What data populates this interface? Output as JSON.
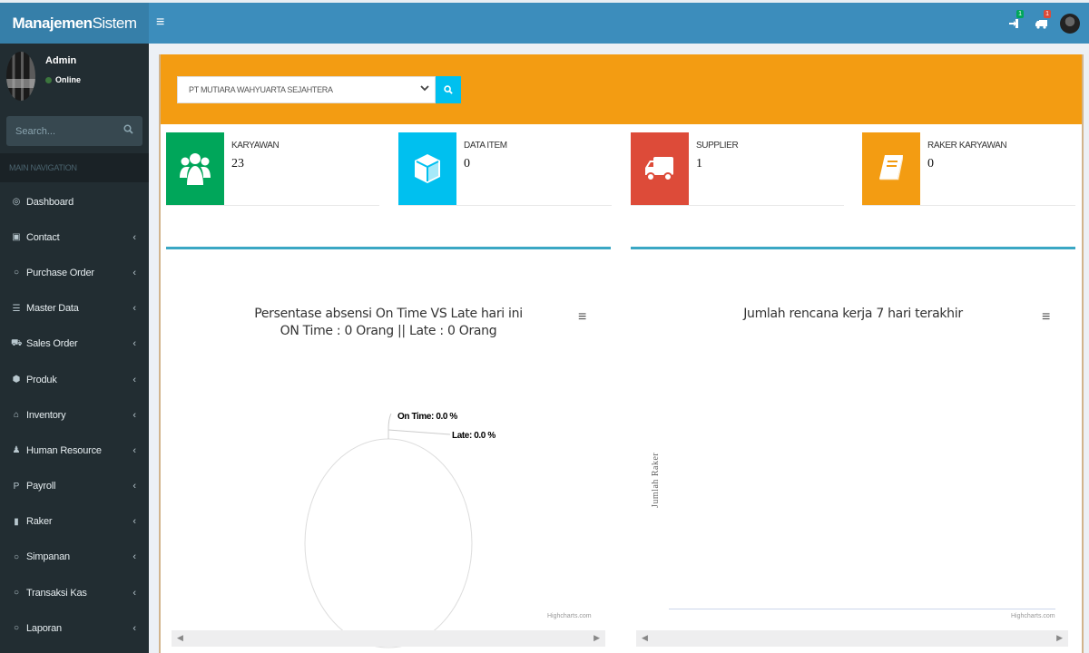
{
  "header": {
    "logo_bold": "Manajemen",
    "logo_light": "Sistem",
    "toggle_icon": "hamburger-icon",
    "notifications": [
      {
        "icon": "sign-in-icon",
        "badge": "1",
        "badge_color": "#00a65a"
      },
      {
        "icon": "truck-icon",
        "badge": "1",
        "badge_color": "#dd4b39"
      }
    ]
  },
  "sidebar": {
    "user": {
      "name": "Admin",
      "status": "Online"
    },
    "search_placeholder": "Search...",
    "nav_header": "MAIN NAVIGATION",
    "items": [
      {
        "label": "Dashboard",
        "icon": "dashboard-icon",
        "glyph": "◎",
        "has_children": false
      },
      {
        "label": "Contact",
        "icon": "phone-square-icon",
        "glyph": "▣",
        "has_children": true
      },
      {
        "label": "Purchase Order",
        "icon": "circle-o-icon",
        "glyph": "○",
        "has_children": true
      },
      {
        "label": "Master Data",
        "icon": "list-icon",
        "glyph": "☰",
        "has_children": true
      },
      {
        "label": "Sales Order",
        "icon": "cart-icon",
        "glyph": "⛟",
        "has_children": true
      },
      {
        "label": "Produk",
        "icon": "cube-icon",
        "glyph": "⬢",
        "has_children": true
      },
      {
        "label": "Inventory",
        "icon": "bank-icon",
        "glyph": "⌂",
        "has_children": true
      },
      {
        "label": "Human Resource",
        "icon": "users-icon",
        "glyph": "♟",
        "has_children": true
      },
      {
        "label": "Payroll",
        "icon": "paypal-icon",
        "glyph": "P",
        "has_children": true
      },
      {
        "label": "Raker",
        "icon": "file-icon",
        "glyph": "▮",
        "has_children": true
      },
      {
        "label": "Simpanan",
        "icon": "circle-o-icon",
        "glyph": "○",
        "has_children": true
      },
      {
        "label": "Transaksi Kas",
        "icon": "circle-o-icon",
        "glyph": "○",
        "has_children": true
      },
      {
        "label": "Laporan",
        "icon": "circle-o-icon",
        "glyph": "○",
        "has_children": true
      }
    ],
    "chevron": "‹"
  },
  "filter": {
    "company_selected": "PT MUTIARA WAHYUARTA SEJAHTERA",
    "header_color": "#f39c12"
  },
  "info_boxes": [
    {
      "label": "KARYAWAN",
      "value": "23",
      "color": "#00a65a",
      "icon": "users-icon"
    },
    {
      "label": "DATA ITEM",
      "value": "0",
      "color": "#00c0ef",
      "icon": "cube-icon"
    },
    {
      "label": "SUPPLIER",
      "value": "1",
      "color": "#dd4b39",
      "icon": "truck-icon"
    },
    {
      "label": "RAKER KARYAWAN",
      "value": "0",
      "color": "#f39c12",
      "icon": "book-icon"
    }
  ],
  "chart_data": [
    {
      "type": "pie",
      "title": "Persentase absensi On Time VS Late hari ini",
      "subtitle": "ON Time : 0 Orang || Late : 0 Orang",
      "slices": [
        {
          "name": "On Time",
          "value": 0,
          "label": "On Time: 0.0 %"
        },
        {
          "name": "Late",
          "value": 0,
          "label": "Late: 0.0 %"
        }
      ],
      "credits": "Highcharts.com"
    },
    {
      "type": "bar",
      "title": "Jumlah rencana kerja 7 hari terakhir",
      "ylabel": "Jumlah Raker",
      "xlabel": "",
      "categories": [],
      "series": [],
      "credits": "Highcharts.com"
    }
  ]
}
